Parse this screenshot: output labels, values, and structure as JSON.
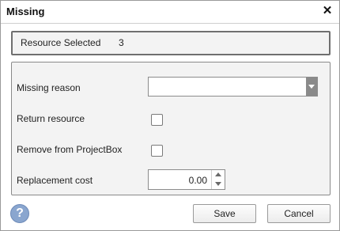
{
  "window": {
    "title": "Missing",
    "close_glyph": "✕",
    "close_icon": "close-icon"
  },
  "resource": {
    "label": "Resource Selected",
    "count": "3"
  },
  "form": {
    "missing_reason": {
      "label": "Missing reason",
      "value": ""
    },
    "return_resource": {
      "label": "Return resource",
      "checked": false
    },
    "remove_projectbox": {
      "label": "Remove from ProjectBox",
      "checked": false
    },
    "replacement_cost": {
      "label": "Replacement cost",
      "value": "0.00"
    }
  },
  "help": {
    "glyph": "?",
    "icon": "help-icon"
  },
  "buttons": {
    "save": "Save",
    "cancel": "Cancel"
  }
}
